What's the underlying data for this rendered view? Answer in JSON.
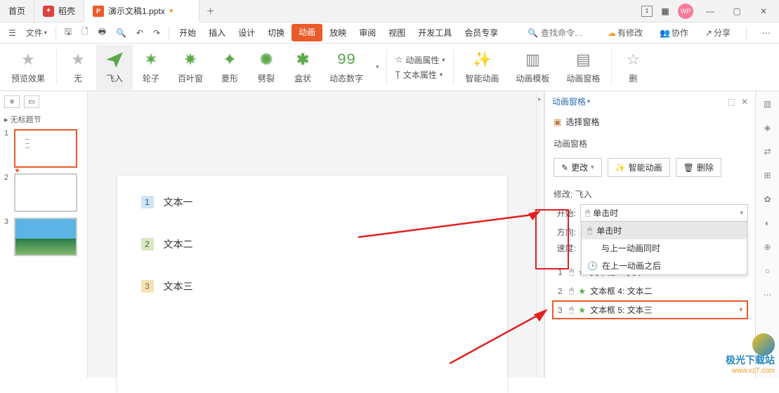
{
  "tabs": {
    "home": "首页",
    "dock": "稻壳",
    "doc": "演示文稿1.pptx"
  },
  "toolbar": {
    "file": "文件",
    "menus": [
      "开始",
      "插入",
      "设计",
      "切换",
      "动画",
      "放映",
      "审阅",
      "视图",
      "开发工具",
      "会员专享"
    ],
    "active_menu": "动画",
    "search_placeholder": "查找命令…",
    "has_changes": "有修改",
    "collab": "协作",
    "share": "分享"
  },
  "ribbon": {
    "preview": "预览效果",
    "effects": [
      "无",
      "飞入",
      "轮子",
      "百叶窗",
      "菱形",
      "劈裂",
      "盒状",
      "动态数字"
    ],
    "selected_effect": "飞入",
    "anim_props": "动画属性",
    "text_props": "文本属性",
    "smart_anim": "智能动画",
    "anim_template": "动画模板",
    "anim_pane": "动画窗格",
    "delete": "删"
  },
  "thumbs": {
    "section": "无标题节"
  },
  "slide": {
    "items": [
      "文本一",
      "文本二",
      "文本三"
    ]
  },
  "panel": {
    "title": "动画窗格",
    "select_pane": "选择窗格",
    "pane_label": "动画窗格",
    "btn_change": "更改",
    "btn_smart": "智能动画",
    "btn_delete": "删除",
    "modify_label": "修改: 飞入",
    "form": {
      "start_lbl": "开始:",
      "dir_lbl": "方向:",
      "speed_lbl": "速度:",
      "start_value": "单击时",
      "options": [
        "单击时",
        "与上一动画同时",
        "在上一动画之后"
      ]
    },
    "anim_list": [
      {
        "idx": "1",
        "label": "文本框 3: 文本一"
      },
      {
        "idx": "2",
        "label": "文本框 4: 文本二"
      },
      {
        "idx": "3",
        "label": "文本框 5: 文本三"
      }
    ]
  },
  "watermark": {
    "t1": "极光下载站",
    "t2": "www.xz7.com"
  }
}
